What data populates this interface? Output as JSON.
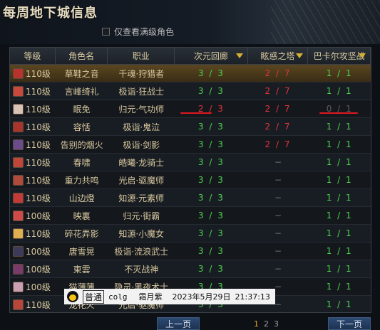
{
  "header": {
    "title": "每周地下城信息",
    "filter_label": "仅查看满级角色"
  },
  "columns": [
    "等级",
    "角色名",
    "职业",
    "次元回廊",
    "眩惑之塔",
    "巴卡尔攻坚战"
  ],
  "rows": [
    {
      "level": "110级",
      "name": "草鞋之音",
      "job": "千魂·狩猎者",
      "dim": "3 / 3",
      "tower": "2 / 7",
      "bakal": "1 / 1",
      "dim_c": "g",
      "tower_c": "r",
      "bakal_c": "g",
      "avatar": "#b8322e"
    },
    {
      "level": "110级",
      "name": "言峰绮礼",
      "job": "极诣·狂战士",
      "dim": "3 / 3",
      "tower": "2 / 7",
      "bakal": "1 / 1",
      "dim_c": "g",
      "tower_c": "r",
      "bakal_c": "g",
      "avatar": "#c84a3c"
    },
    {
      "level": "110级",
      "name": "眠免",
      "job": "归元·气功师",
      "dim": "2 / 3",
      "tower": "2 / 7",
      "bakal": "0 / 1",
      "dim_c": "r",
      "tower_c": "r",
      "bakal_c": "d",
      "avatar": "#d8c2b6"
    },
    {
      "level": "110级",
      "name": "容恬",
      "job": "极诣·鬼泣",
      "dim": "3 / 3",
      "tower": "2 / 7",
      "bakal": "1 / 1",
      "dim_c": "g",
      "tower_c": "r",
      "bakal_c": "g",
      "avatar": "#a8342c"
    },
    {
      "level": "110级",
      "name": "告别的烟火",
      "job": "极诣·剑影",
      "dim": "3 / 3",
      "tower": "2 / 7",
      "bakal": "1 / 1",
      "dim_c": "g",
      "tower_c": "r",
      "bakal_c": "g",
      "avatar": "#6a4c8a"
    },
    {
      "level": "110级",
      "name": "春啸",
      "job": "皓曦·龙骑士",
      "dim": "3 / 3",
      "tower": "−",
      "bakal": "1 / 1",
      "dim_c": "g",
      "tower_c": "dash",
      "bakal_c": "g",
      "avatar": "#c0463a"
    },
    {
      "level": "110级",
      "name": "重力共鸣",
      "job": "光启·驱魔师",
      "dim": "3 / 3",
      "tower": "−",
      "bakal": "1 / 1",
      "dim_c": "g",
      "tower_c": "dash",
      "bakal_c": "g",
      "avatar": "#b04a3a"
    },
    {
      "level": "110级",
      "name": "山边燈",
      "job": "知源·元素师",
      "dim": "3 / 3",
      "tower": "−",
      "bakal": "1 / 1",
      "dim_c": "g",
      "tower_c": "dash",
      "bakal_c": "g",
      "avatar": "#c43a36"
    },
    {
      "level": "100级",
      "name": "映裏",
      "job": "归元·街霸",
      "dim": "3 / 3",
      "tower": "−",
      "bakal": "1 / 1",
      "dim_c": "g",
      "tower_c": "dash",
      "bakal_c": "g",
      "avatar": "#d04a4a"
    },
    {
      "level": "110级",
      "name": "碎花弄影",
      "job": "知源·小魔女",
      "dim": "3 / 3",
      "tower": "−",
      "bakal": "1 / 1",
      "dim_c": "g",
      "tower_c": "dash",
      "bakal_c": "g",
      "avatar": "#e0b050"
    },
    {
      "level": "100级",
      "name": "唐雪晃",
      "job": "极诣·流浪武士",
      "dim": "3 / 3",
      "tower": "−",
      "bakal": "1 / 1",
      "dim_c": "g",
      "tower_c": "dash",
      "bakal_c": "g",
      "avatar": "#3c3a58"
    },
    {
      "level": "100级",
      "name": "東雲",
      "job": "不灭战神",
      "dim": "3 / 3",
      "tower": "−",
      "bakal": "1 / 1",
      "dim_c": "g",
      "tower_c": "dash",
      "bakal_c": "g",
      "avatar": "#7a3a6a"
    },
    {
      "level": "100级",
      "name": "猫薄薄",
      "job": "隐灵·黑夜术士",
      "dim": "3 / 3",
      "tower": "−",
      "bakal": "1 / 1",
      "dim_c": "g",
      "tower_c": "dash",
      "bakal_c": "g",
      "avatar": "#caa0b0"
    },
    {
      "level": "110级",
      "name": "龙花火",
      "job": "光启·驱魔师",
      "dim": "3 / 3",
      "tower": "−",
      "bakal": "1 / 1",
      "dim_c": "g",
      "tower_c": "dash",
      "bakal_c": "g",
      "avatar": "#b8463a"
    }
  ],
  "overlay": {
    "tag": "普通",
    "user": "colg",
    "name": "霜月紫",
    "date": "2023年5月29日",
    "time": "21:37:13"
  },
  "pager": {
    "prev": "上一页",
    "next": "下一页",
    "pages": [
      "1",
      "2",
      "3"
    ]
  },
  "colors": {
    "green": "#4fd04f",
    "red": "#e2333a",
    "gold": "#d6b030",
    "selected_row": "#5a4620"
  }
}
